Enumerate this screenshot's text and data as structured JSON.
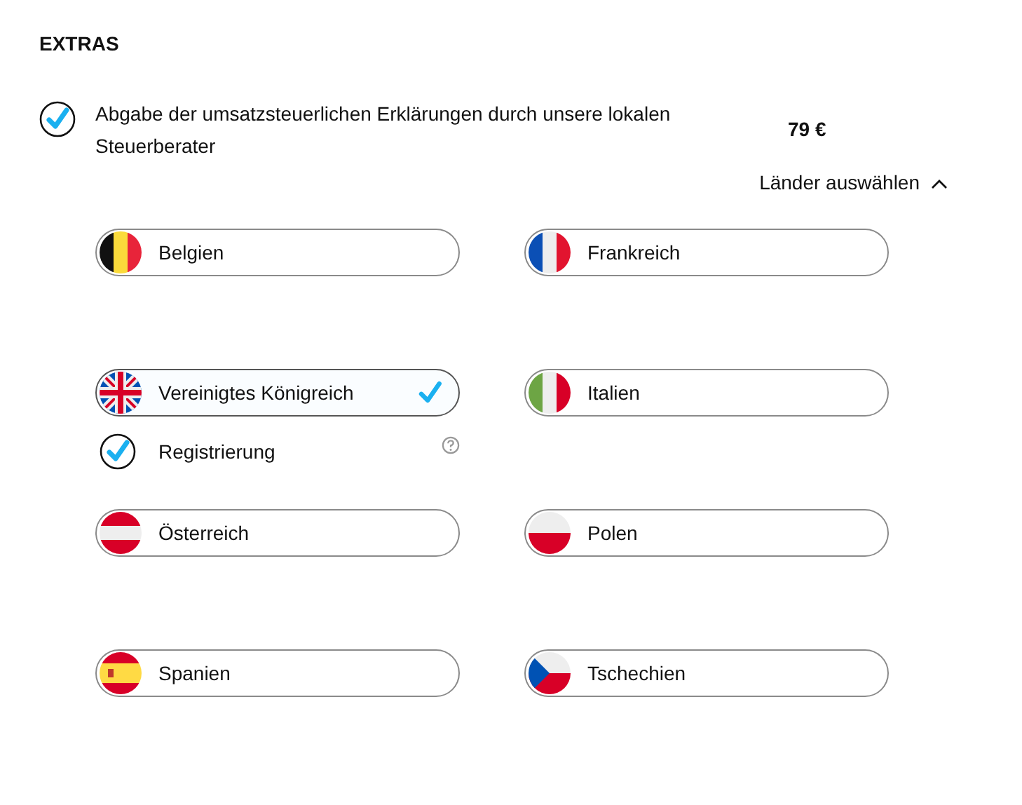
{
  "section_title": "EXTRAS",
  "extra": {
    "checked": true,
    "label": "Abgabe der umsatzsteuerlichen Erklärungen durch unsere lokalen Steuerberater",
    "price": "79 €"
  },
  "countries_toggle": {
    "label": "Länder auswählen",
    "expanded": true
  },
  "countries": [
    {
      "name": "Belgien",
      "kind": "be",
      "selected": false
    },
    {
      "name": "Frankreich",
      "kind": "fr",
      "selected": false
    },
    {
      "name": "Vereinigtes Königreich",
      "kind": "gb",
      "selected": true,
      "option": {
        "label": "Registrierung",
        "checked": true
      }
    },
    {
      "name": "Italien",
      "kind": "it",
      "selected": false
    },
    {
      "name": "Österreich",
      "kind": "at",
      "selected": false
    },
    {
      "name": "Polen",
      "kind": "pl",
      "selected": false
    },
    {
      "name": "Spanien",
      "kind": "es",
      "selected": false
    },
    {
      "name": "Tschechien",
      "kind": "cz",
      "selected": false
    }
  ]
}
